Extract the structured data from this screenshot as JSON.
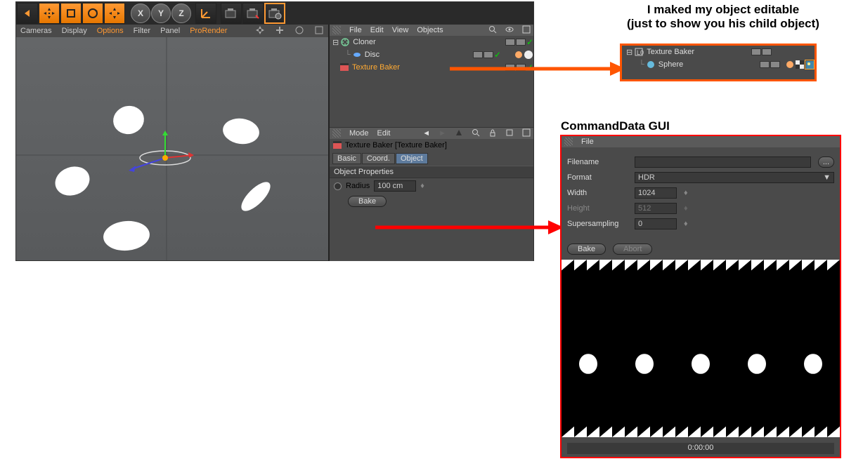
{
  "main": {
    "topmenus": {
      "file": "File",
      "edit": "Edit",
      "view": "View",
      "objects": "Objects"
    },
    "submenu": {
      "cameras": "Cameras",
      "display": "Display",
      "options": "Options",
      "filter": "Filter",
      "panel": "Panel",
      "prorender": "ProRender"
    },
    "tree": {
      "cloner": "Cloner",
      "disc": "Disc",
      "texture_baker": "Texture Baker"
    },
    "attrib": {
      "mode": "Mode",
      "edit": "Edit",
      "title": "Texture Baker [Texture Baker]",
      "tabs": {
        "basic": "Basic",
        "coord": "Coord.",
        "object": "Object"
      },
      "section": "Object Properties",
      "radius_label": "Radius",
      "radius_value": "100 cm",
      "bake": "Bake"
    }
  },
  "annotation1_l1": "I maked my object editable",
  "annotation1_l2": "(just to show you his child object)",
  "annotation2": "CommandData GUI",
  "callout1": {
    "texture_baker": "Texture Baker",
    "sphere": "Sphere"
  },
  "gui": {
    "file": "File",
    "filename_label": "Filename",
    "filename_value": "",
    "browse": "...",
    "format_label": "Format",
    "format_value": "HDR",
    "width_label": "Width",
    "width_value": "1024",
    "height_label": "Height",
    "height_value": "512",
    "ss_label": "Supersampling",
    "ss_value": "0",
    "bake": "Bake",
    "abort": "Abort",
    "time": "0:00:00"
  }
}
